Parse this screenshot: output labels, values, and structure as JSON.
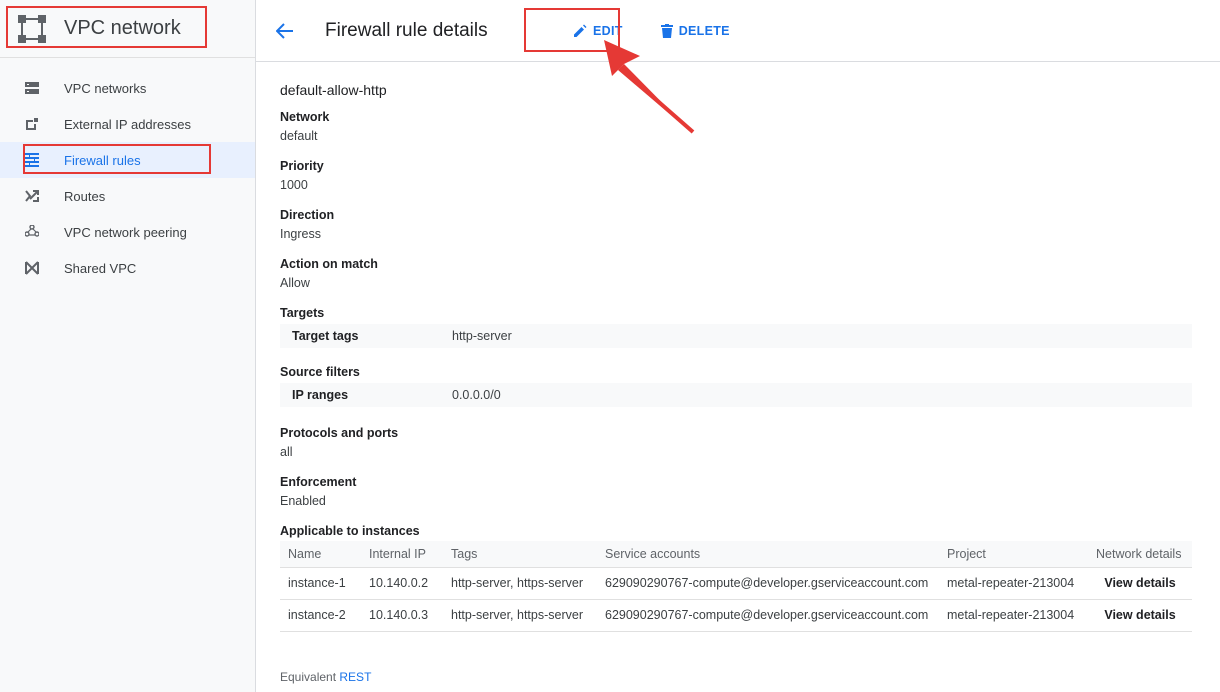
{
  "sidebar": {
    "title": "VPC network",
    "items": [
      {
        "label": "VPC networks",
        "icon": "vpc-networks-icon"
      },
      {
        "label": "External IP addresses",
        "icon": "external-ip-icon"
      },
      {
        "label": "Firewall rules",
        "icon": "firewall-icon",
        "active": true
      },
      {
        "label": "Routes",
        "icon": "routes-icon"
      },
      {
        "label": "VPC network peering",
        "icon": "peering-icon"
      },
      {
        "label": "Shared VPC",
        "icon": "shared-vpc-icon"
      }
    ]
  },
  "header": {
    "title": "Firewall rule details",
    "edit_label": "EDIT",
    "delete_label": "DELETE"
  },
  "rule": {
    "name": "default-allow-http",
    "network_label": "Network",
    "network": "default",
    "priority_label": "Priority",
    "priority": "1000",
    "direction_label": "Direction",
    "direction": "Ingress",
    "action_label": "Action on match",
    "action": "Allow",
    "targets_label": "Targets",
    "target_tags_key": "Target tags",
    "target_tags": "http-server",
    "source_filters_label": "Source filters",
    "ip_ranges_key": "IP ranges",
    "ip_ranges": "0.0.0.0/0",
    "protocols_label": "Protocols and ports",
    "protocols": "all",
    "enforcement_label": "Enforcement",
    "enforcement": "Enabled",
    "instances_label": "Applicable to instances"
  },
  "instances": {
    "columns": [
      "Name",
      "Internal IP",
      "Tags",
      "Service accounts",
      "Project",
      "Network details"
    ],
    "rows": [
      {
        "name": "instance-1",
        "ip": "10.140.0.2",
        "tags": "http-server, https-server",
        "service_account": "629090290767-compute@developer.gserviceaccount.com",
        "project": "metal-repeater-213004",
        "details": "View details"
      },
      {
        "name": "instance-2",
        "ip": "10.140.0.3",
        "tags": "http-server, https-server",
        "service_account": "629090290767-compute@developer.gserviceaccount.com",
        "project": "metal-repeater-213004",
        "details": "View details"
      }
    ]
  },
  "footer": {
    "prefix": "Equivalent",
    "link": "REST"
  },
  "colors": {
    "accent": "#1a73e8",
    "annotation": "#e53935"
  }
}
